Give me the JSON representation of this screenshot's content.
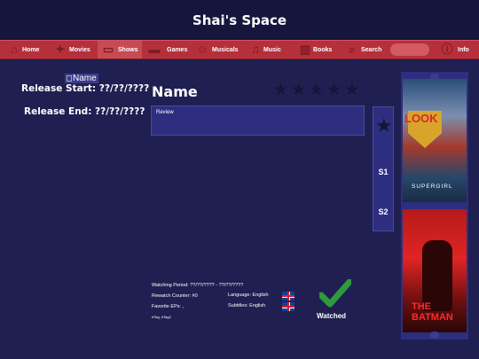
{
  "header": {
    "title": "Shai's Space"
  },
  "nav": {
    "items": [
      {
        "label": "Home",
        "icon": "home-icon"
      },
      {
        "label": "Movies",
        "icon": "movies-icon"
      },
      {
        "label": "Shows",
        "icon": "shows-icon"
      },
      {
        "label": "Games",
        "icon": "games-icon"
      },
      {
        "label": "Musicals",
        "icon": "musicals-icon"
      },
      {
        "label": "Music",
        "icon": "music-icon"
      },
      {
        "label": "Books",
        "icon": "books-icon"
      },
      {
        "label": "Search",
        "icon": "search-icon"
      },
      {
        "label": "Info",
        "icon": "info-icon"
      }
    ],
    "active": "Shows"
  },
  "show": {
    "image_alt": "Name",
    "release_start": "Release Start: ??/??/????",
    "release_end": "Release End: ??/??/????",
    "name": "Name",
    "review_placeholder": "Review",
    "rating_max": 5,
    "rating": 0
  },
  "seasons": [
    "S1",
    "S2"
  ],
  "details": {
    "watching_period": "Watching Period: ??/??/???? - ??/??/????",
    "rewatch_counter": "Rewatch Counter: #0",
    "favorite_eps": "Favorite EPs: ,",
    "tags": "#Tag, #Tag2",
    "language": "Language: English",
    "subtitles": "Subtitles: English",
    "watched_label": "Watched"
  },
  "carousel": {
    "posters": [
      {
        "title_line": "LOOK",
        "subtitle": "SUPERGIRL"
      },
      {
        "title_line": "THE BATMAN"
      }
    ]
  },
  "colors": {
    "background": "#1f1f52",
    "header": "#16163d",
    "nav": "#b5303a",
    "panel": "#2e2e80",
    "check": "#2e9a3e"
  }
}
